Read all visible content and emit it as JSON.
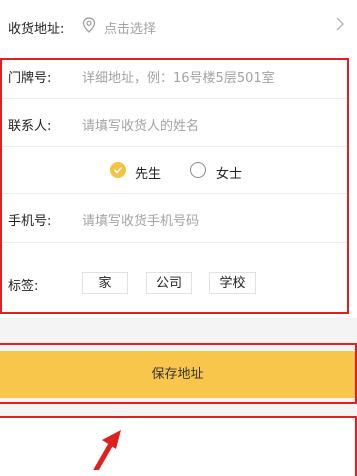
{
  "delivery": {
    "label": "收货地址:",
    "placeholder": "点击选择"
  },
  "door": {
    "label": "门牌号:",
    "placeholder": "详细地址，例：16号楼5层501室"
  },
  "contact": {
    "label": "联系人:",
    "placeholder": "请填写收货人的姓名"
  },
  "gender": {
    "male": "先生",
    "female": "女士",
    "selected": "先生"
  },
  "phone": {
    "label": "手机号:",
    "placeholder": "请填写收货手机号码"
  },
  "tags": {
    "label": "标签:",
    "items": [
      "家",
      "公司",
      "学校"
    ]
  },
  "save_label": "保存地址",
  "colors": {
    "accent": "#f8c64a",
    "highlight": "#e02020"
  }
}
